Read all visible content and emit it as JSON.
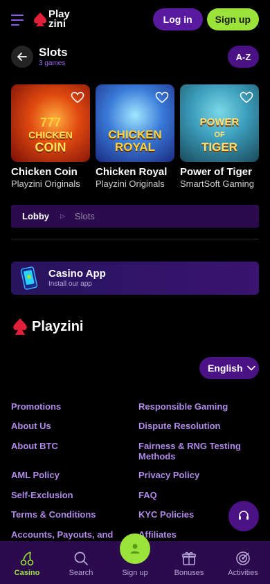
{
  "header": {
    "logo_line1": "Play",
    "logo_line2": "zini",
    "login_label": "Log in",
    "signup_label": "Sign up"
  },
  "section": {
    "title": "Slots",
    "subtitle": "3 games",
    "sort_label": "A-Z"
  },
  "games": [
    {
      "art_line1": "777",
      "art_line2": "CHICKEN",
      "art_line3": "COIN",
      "name": "Chicken Coin",
      "provider": "Playzini Originals"
    },
    {
      "art_line1": "",
      "art_line2": "CHICKEN",
      "art_line3": "ROYAL",
      "name": "Chicken Royal",
      "provider": "Playzini Originals"
    },
    {
      "art_line1": "POWER",
      "art_line2": "OF",
      "art_line3": "TIGER",
      "name": "Power of Tiger",
      "provider": "SmartSoft Gaming"
    }
  ],
  "breadcrumb": {
    "items": [
      "Lobby",
      "Slots"
    ]
  },
  "app_banner": {
    "title": "Casino App",
    "subtitle": "Install our app"
  },
  "footer": {
    "logo_word": "Playzini",
    "language": "English",
    "links_left": [
      "Promotions",
      "About Us",
      "About BTC",
      "AML Policy",
      "Self-Exclusion",
      "Terms & Conditions",
      "Accounts, Payouts, and"
    ],
    "links_right": [
      "Responsible Gaming",
      "Dispute Resolution",
      "Fairness & RNG Testing Methods",
      "Privacy Policy",
      "FAQ",
      "KYC Policies",
      "Affiliates"
    ]
  },
  "nav": {
    "items": [
      "Casino",
      "Search",
      "Sign up",
      "Bonuses",
      "Activities"
    ],
    "active": "Casino"
  },
  "colors": {
    "accent_green": "#9be33a",
    "accent_purple": "#4a1285",
    "link_purple": "#b08ae8"
  }
}
